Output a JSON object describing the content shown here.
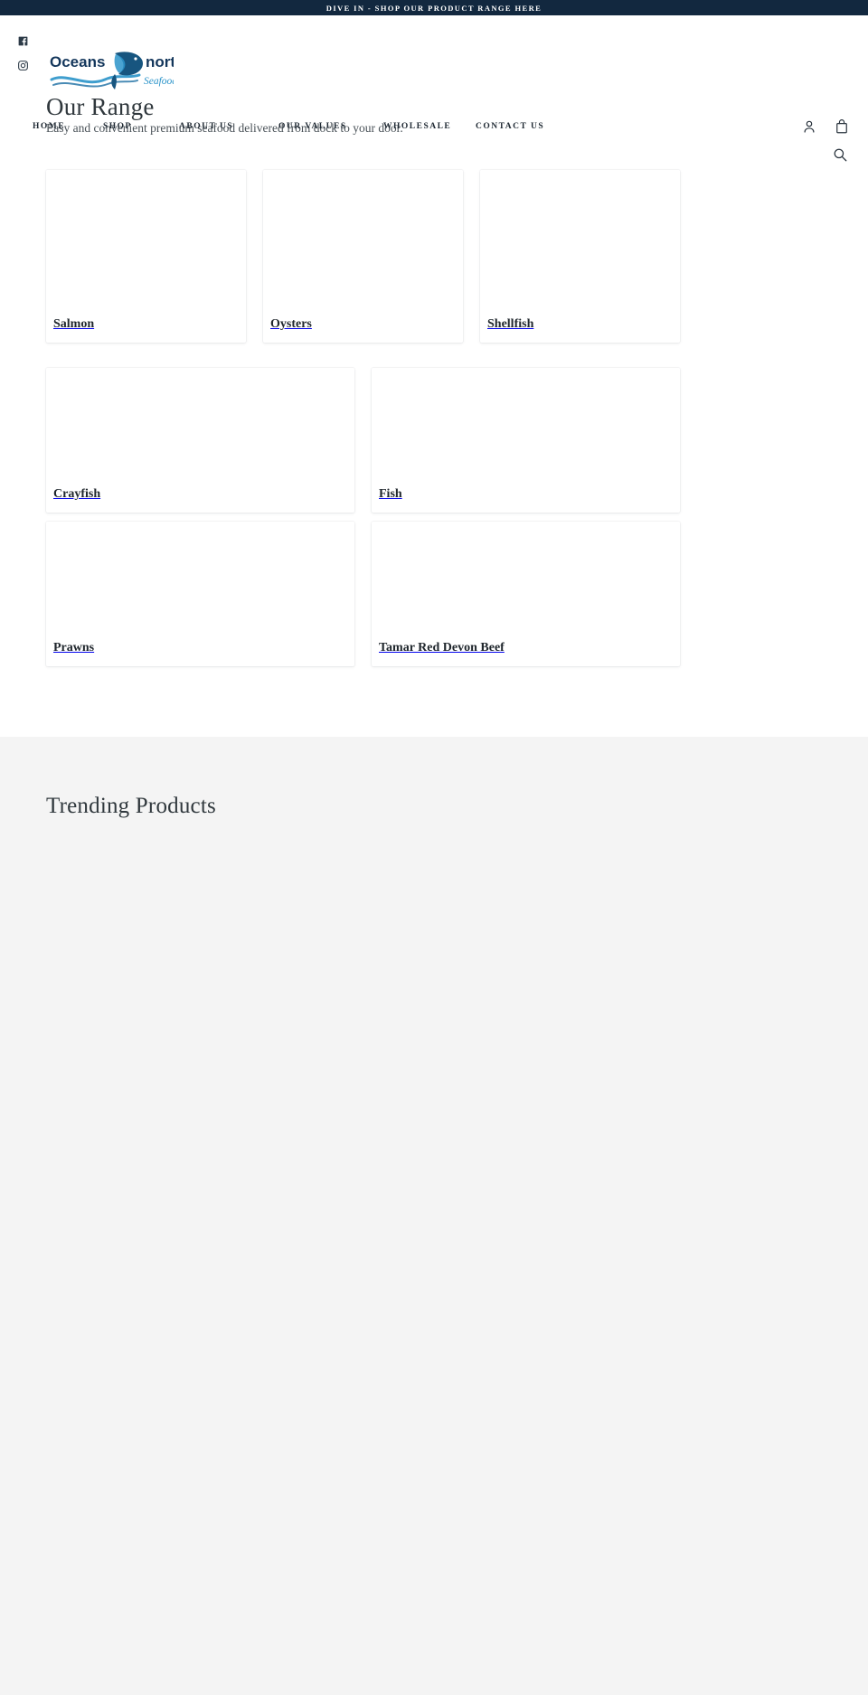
{
  "announcement": {
    "text": "DIVE IN - SHOP OUR PRODUCT RANGE HERE"
  },
  "social": [
    {
      "name": "facebook-icon",
      "label": "Facebook"
    },
    {
      "name": "instagram-icon",
      "label": "Instagram"
    }
  ],
  "brand": {
    "word_one": "Oceans",
    "word_two": "north",
    "tagline_word": "Seafood",
    "colors": {
      "dark_navy": "#12283f",
      "logo_navy": "#14375c",
      "logo_blue": "#2a93c9",
      "page_bg": "#ffffff",
      "section_bg": "#f4f4f4",
      "text": "#1f2933"
    }
  },
  "page": {
    "title": "Our Range",
    "tagline": "Easy and convenient premium seafood delivered from dock to your door."
  },
  "nav": {
    "items": [
      {
        "label": "HOME",
        "key": "home"
      },
      {
        "label": "SHOP",
        "key": "shop"
      },
      {
        "label": "ABOUT US",
        "key": "about-us"
      },
      {
        "label": "OUR VALUES",
        "key": "our-values"
      },
      {
        "label": "WHOLESALE",
        "key": "wholesale"
      },
      {
        "label": "CONTACT US",
        "key": "contact-us"
      }
    ]
  },
  "header_icons": [
    {
      "name": "account-icon",
      "label": "Account"
    },
    {
      "name": "cart-icon",
      "label": "Cart"
    },
    {
      "name": "search-icon",
      "label": "Search"
    }
  ],
  "collections": {
    "row_one": [
      {
        "title": "Salmon"
      },
      {
        "title": "Oysters"
      },
      {
        "title": "Shellfish"
      }
    ],
    "row_two": [
      {
        "title": "Crayfish"
      },
      {
        "title": "Fish"
      }
    ],
    "row_three": [
      {
        "title": "Prawns"
      },
      {
        "title": "Tamar Red Devon Beef"
      }
    ]
  },
  "trending": {
    "title": "Trending Products"
  }
}
